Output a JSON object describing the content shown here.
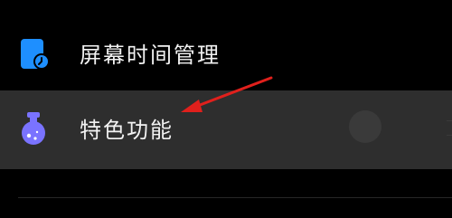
{
  "settings_list": {
    "items": [
      {
        "label": "屏幕时间管理",
        "icon": "hourglass-phone-icon",
        "accent": "#1e8fff"
      },
      {
        "label": "特色功能",
        "icon": "potion-flask-icon",
        "accent": "#7a73ff",
        "highlighted": true
      }
    ]
  },
  "annotation": {
    "arrow_color": "#e0201c"
  }
}
